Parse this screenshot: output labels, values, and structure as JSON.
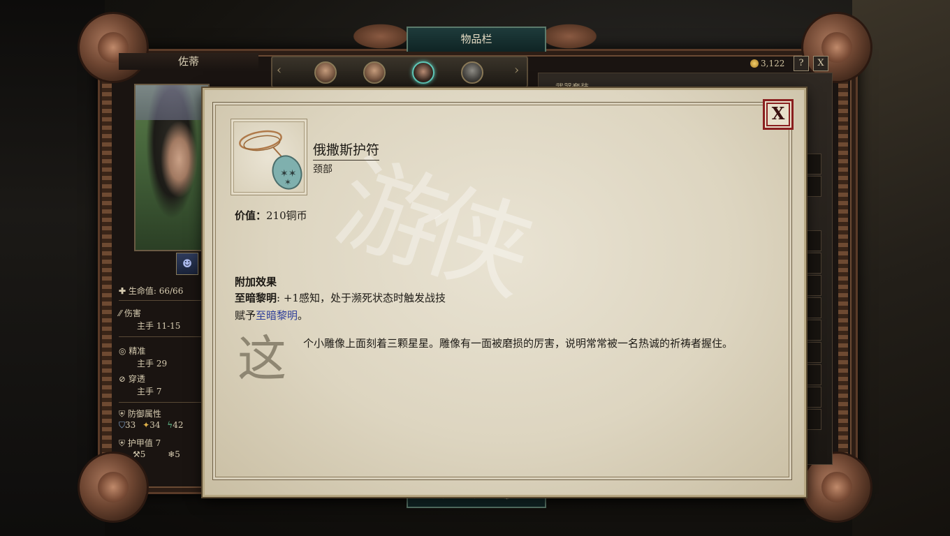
{
  "window": {
    "title": "物品栏",
    "character_name": "佐蒂",
    "money": "3,122",
    "help_label": "?",
    "close_label": "X"
  },
  "party": {
    "prev_arrow": "‹",
    "next_arrow": "›",
    "members": [
      {
        "name": "member-1"
      },
      {
        "name": "member-2"
      },
      {
        "name": "member-3",
        "selected": true
      },
      {
        "name": "member-4"
      }
    ]
  },
  "stats": {
    "health": "生命值: 66/66",
    "damage_label": "伤害",
    "damage_value": "主手 11-15",
    "accuracy_label": "精准",
    "accuracy_value": "主手 29",
    "penetration_label": "穿透",
    "penetration_value": "主手 7",
    "defense_label": "防御属性",
    "defense_values": [
      "33",
      "34",
      "42"
    ],
    "armor_label": "护甲值 7",
    "armor_values": [
      "5",
      "5"
    ]
  },
  "right_panel": {
    "label": "武器套装"
  },
  "item": {
    "name": "俄撒斯护符",
    "slot": "颈部",
    "value_label": "价值：",
    "value": "210铜币",
    "effects_title": "附加效果",
    "effect_name": "至暗黎明",
    "effect_desc": ": +1感知，处于濒死状态时触发战技",
    "grant_prefix": "赋予",
    "grant_link": "至暗黎明",
    "grant_suffix": "。",
    "drop_cap": "这",
    "description": "个小雕像上面刻着三颗星星。雕像有一面被磨损的厉害，说明常常被一名热诚的祈祷者握住。",
    "close_label": "X"
  },
  "colors": {
    "parchment": "#ddd5c0",
    "close_border": "#8a1f1f",
    "link": "#2f3f9a",
    "frame": "#5a3b28",
    "teal_tab": "#1e3b3b"
  }
}
